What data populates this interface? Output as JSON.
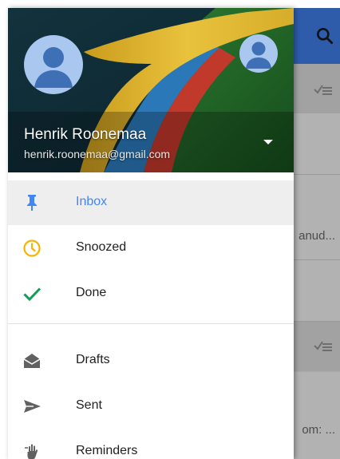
{
  "background_app": {
    "snippets": [
      "anud...",
      "om: ..."
    ]
  },
  "account": {
    "name": "Henrik Roonemaa",
    "email": "henrik.roonemaa@gmail.com"
  },
  "menu": {
    "primary": [
      {
        "label": "Inbox",
        "icon": "pin-icon",
        "active": true
      },
      {
        "label": "Snoozed",
        "icon": "clock-icon",
        "active": false
      },
      {
        "label": "Done",
        "icon": "check-icon",
        "active": false
      }
    ],
    "secondary": [
      {
        "label": "Drafts",
        "icon": "drafts-icon"
      },
      {
        "label": "Sent",
        "icon": "send-icon"
      },
      {
        "label": "Reminders",
        "icon": "reminder-icon"
      }
    ]
  },
  "colors": {
    "accent": "#4285f4",
    "snooze": "#f4b400",
    "done": "#0f9d58"
  }
}
